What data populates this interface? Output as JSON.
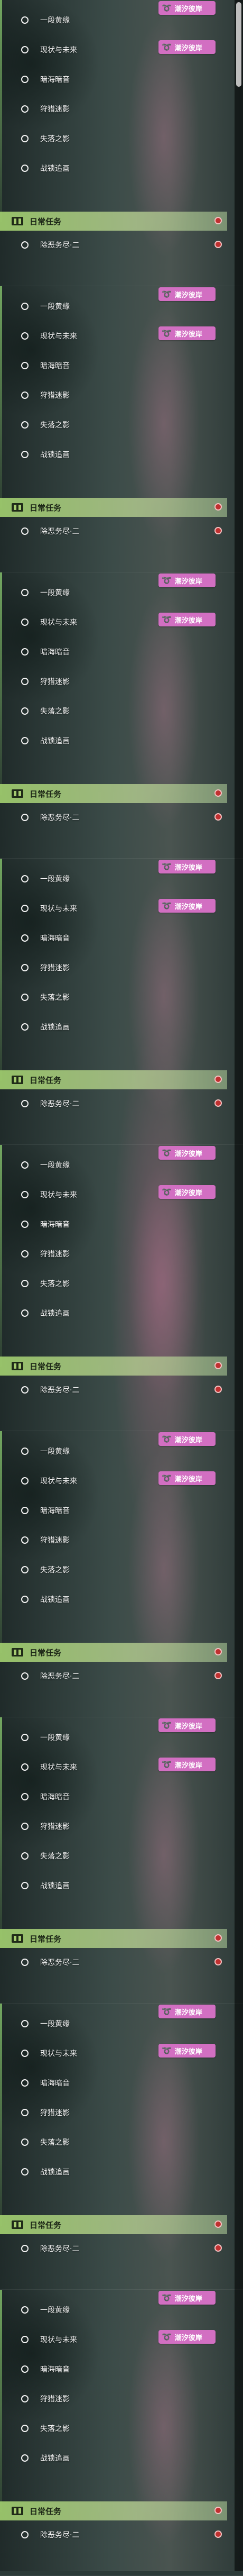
{
  "badge": {
    "text": "潮汐彼岸",
    "icon": "swirl-logo-icon"
  },
  "tasks": [
    "一段黄缘",
    "现状与未来",
    "暗海暗音",
    "狩猎迷影",
    "失落之影",
    "战锁追画"
  ],
  "section": {
    "title": "日常任务",
    "icon": "book-icon"
  },
  "subtask": {
    "label": "除恶务尽·二"
  },
  "colors": {
    "badge": "#d26fc2",
    "header": "#a6cc70",
    "marker": "#c03030"
  }
}
